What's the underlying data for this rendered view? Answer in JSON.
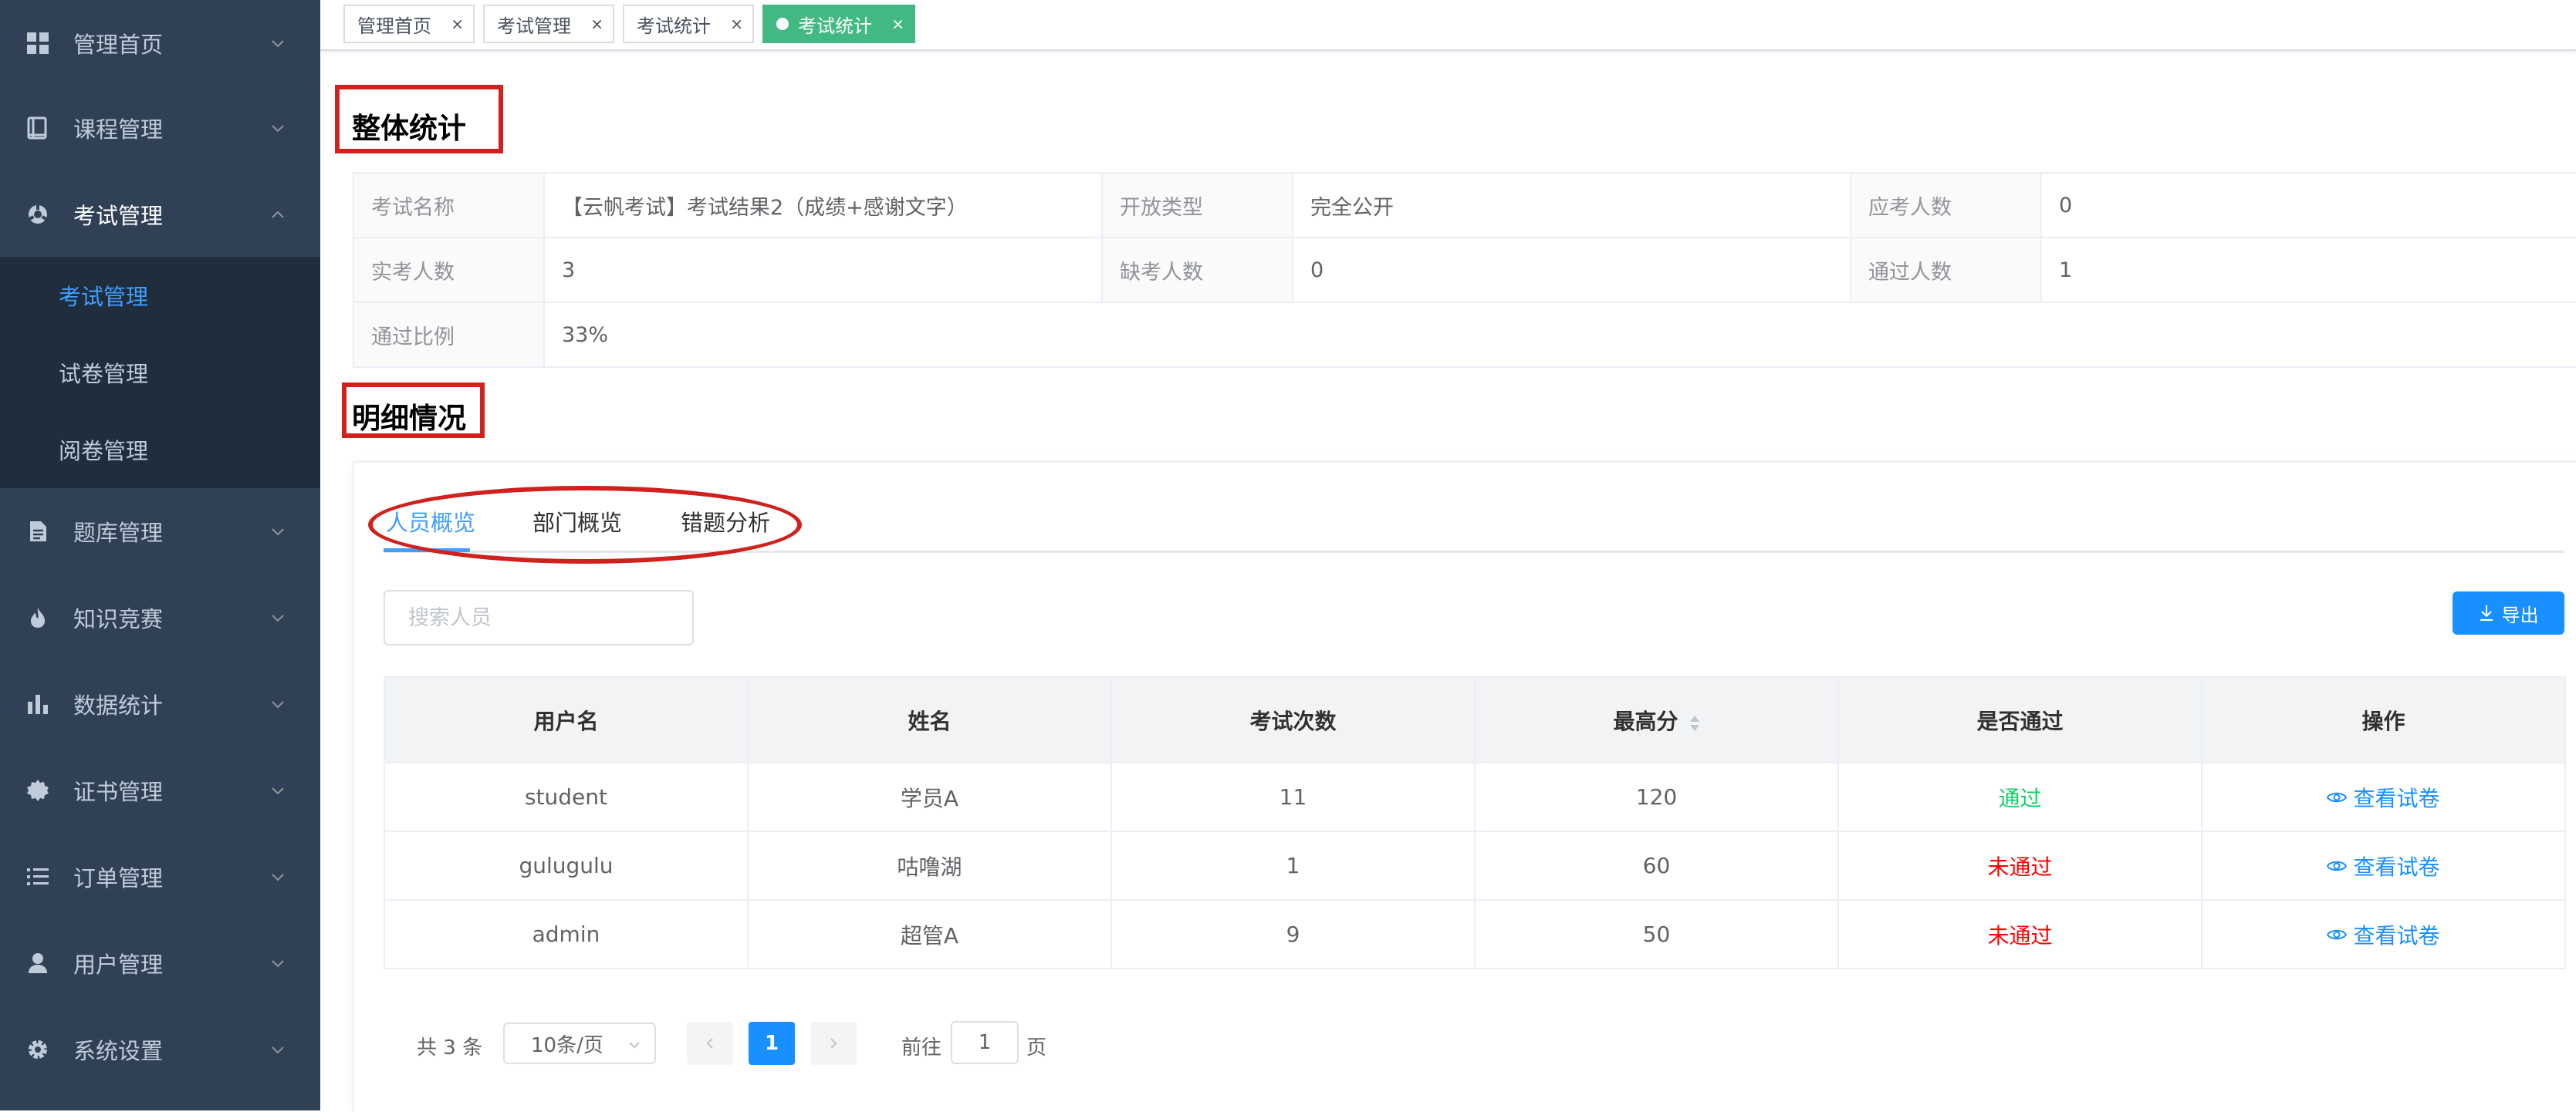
{
  "sidebar": {
    "items": [
      {
        "label": "管理首页",
        "icon": "dashboard-grid-icon"
      },
      {
        "label": "课程管理",
        "icon": "book-icon"
      },
      {
        "label": "考试管理",
        "icon": "exam-icon",
        "expanded": true
      },
      {
        "label": "题库管理",
        "icon": "document-icon"
      },
      {
        "label": "知识竞赛",
        "icon": "flame-icon"
      },
      {
        "label": "数据统计",
        "icon": "bar-chart-icon"
      },
      {
        "label": "证书管理",
        "icon": "badge-icon"
      },
      {
        "label": "订单管理",
        "icon": "list-icon"
      },
      {
        "label": "用户管理",
        "icon": "user-icon"
      },
      {
        "label": "系统设置",
        "icon": "gear-icon"
      }
    ],
    "submenu": [
      {
        "label": "考试管理",
        "active": true
      },
      {
        "label": "试卷管理",
        "active": false
      },
      {
        "label": "阅卷管理",
        "active": false
      }
    ]
  },
  "tags": [
    {
      "label": "管理首页",
      "close": "×"
    },
    {
      "label": "考试管理",
      "close": "×"
    },
    {
      "label": "考试统计",
      "close": "×"
    },
    {
      "label": "考试统计",
      "close": "×",
      "active": true
    }
  ],
  "overview": {
    "title": "整体统计",
    "fields": [
      {
        "label": "考试名称",
        "value": "【云帆考试】考试结果2（成绩+感谢文字）"
      },
      {
        "label": "开放类型",
        "value": "完全公开"
      },
      {
        "label": "应考人数",
        "value": "0"
      },
      {
        "label": "实考人数",
        "value": "3"
      },
      {
        "label": "缺考人数",
        "value": "0"
      },
      {
        "label": "通过人数",
        "value": "1"
      },
      {
        "label": "通过比例",
        "value": "33%"
      }
    ]
  },
  "detail": {
    "title": "明细情况",
    "tabs": [
      "人员概览",
      "部门概览",
      "错题分析"
    ],
    "active_tab": 0,
    "search_placeholder": "搜索人员",
    "export_label": "导出"
  },
  "table": {
    "columns": [
      "用户名",
      "姓名",
      "考试次数",
      "最高分",
      "是否通过",
      "操作"
    ],
    "rows": [
      {
        "username": "student",
        "name": "学员A",
        "count": "11",
        "score": "120",
        "passed": "通过",
        "is_pass": true,
        "action": "查看试卷"
      },
      {
        "username": "gulugulu",
        "name": "咕噜湖",
        "count": "1",
        "score": "60",
        "passed": "未通过",
        "is_pass": false,
        "action": "查看试卷"
      },
      {
        "username": "admin",
        "name": "超管A",
        "count": "9",
        "score": "50",
        "passed": "未通过",
        "is_pass": false,
        "action": "查看试卷"
      }
    ]
  },
  "pagination": {
    "total": "共 3 条",
    "page_size": "10条/页",
    "current": "1",
    "goto_label": "前往",
    "goto_value": "1",
    "page_suffix": "页"
  },
  "colors": {
    "sidebar_bg": "#304156",
    "submenu_bg": "#1f2d3d",
    "accent": "#409eff",
    "active_tag": "#42b983",
    "pass": "#13ce66",
    "fail": "#ff0000",
    "annotation_red": "#d0211c"
  }
}
